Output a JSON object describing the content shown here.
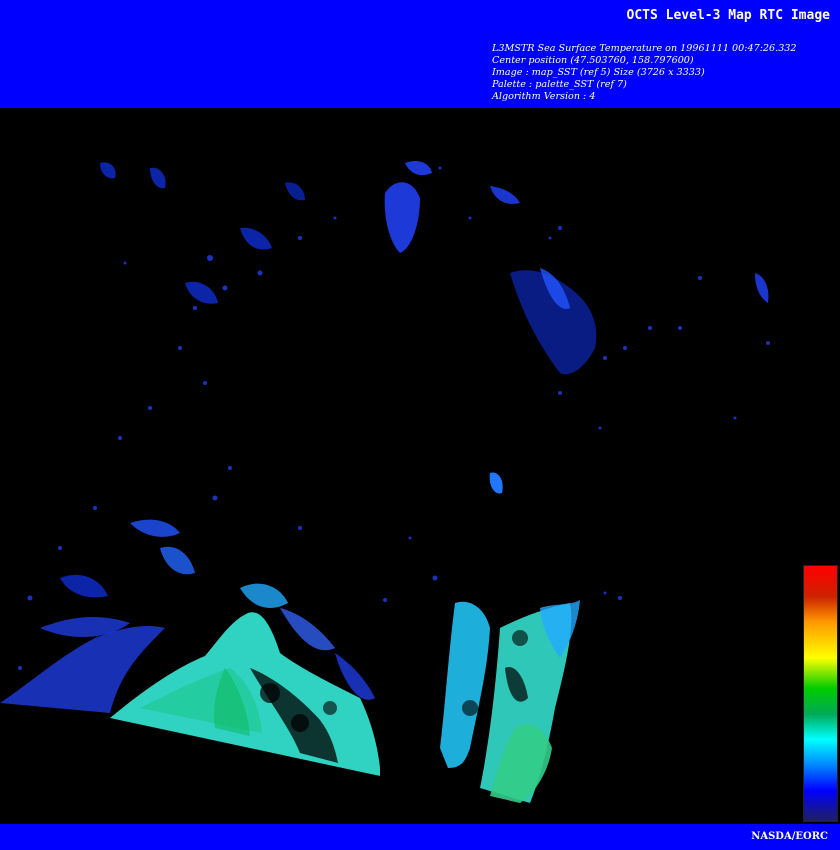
{
  "header": {
    "title": "OCTS Level-3 Map RTC Image",
    "lines": [
      "L3MSTR Sea Surface Temperature on 19961111 00:47:26.332",
      "Center position (47.503760, 158.797600)",
      "Image : map_SST (ref 5) Size (3726 x 3333)",
      "Palette : palette_SST (ref 7)",
      "Algorithm Version : 4"
    ]
  },
  "footer": {
    "credit": "NASDA/EORC"
  },
  "colors": {
    "banner": "#0000ff",
    "background": "#000000",
    "palette": [
      "#ff0000",
      "#cc2200",
      "#ff9900",
      "#ffff00",
      "#00cc00",
      "#00aa55",
      "#00ffff",
      "#0088ff",
      "#0000ff",
      "#202060"
    ]
  }
}
